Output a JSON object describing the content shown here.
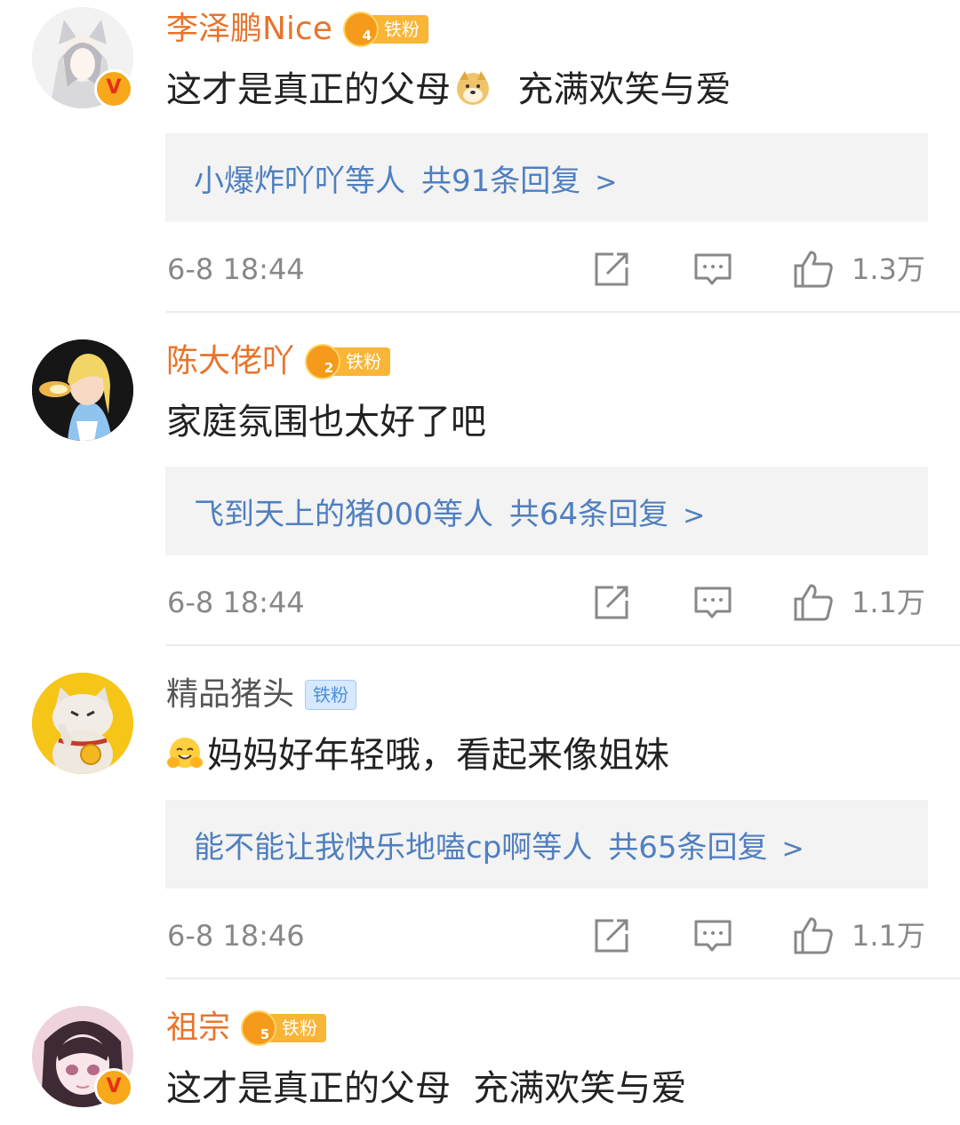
{
  "comments": [
    {
      "username": "李泽鹏Nice",
      "name_style": "vip",
      "verified": true,
      "fan_level": "4",
      "fan_label": "铁粉",
      "text_before": "这才是真正的父母",
      "emoji": "doge-emoji",
      "text_after": "  充满欢笑与爱",
      "reply_users": "小爆炸吖吖",
      "reply_suffix": "等人",
      "reply_count": "共91条回复",
      "time": "6-8 18:44",
      "likes": "1.3万"
    },
    {
      "username": "陈大佬吖",
      "name_style": "vip",
      "verified": false,
      "fan_level": "2",
      "fan_label": "铁粉",
      "text": "家庭氛围也太好了吧",
      "reply_users": "飞到天上的猪000",
      "reply_suffix": "等人",
      "reply_count": "共64条回复",
      "time": "6-8 18:44",
      "likes": "1.1万"
    },
    {
      "username": "精品猪头",
      "name_style": "plain",
      "verified": false,
      "fan_label": "铁粉",
      "emoji": "hug-emoji",
      "text": "妈妈好年轻哦，看起来像姐妹",
      "reply_users": "能不能让我快乐地嗑cp啊",
      "reply_suffix": "等人",
      "reply_count": "共65条回复",
      "time": "6-8 18:46",
      "likes": "1.1万"
    },
    {
      "username": "祖宗",
      "name_style": "vip",
      "verified": true,
      "fan_level": "5",
      "fan_label": "铁粉",
      "text": "这才是真正的父母  充满欢笑与爱"
    }
  ],
  "reply_chevron": ">",
  "colors": {
    "vip_name": "#e8742c",
    "link_blue": "#4f7fbf",
    "reply_bg": "#f3f3f3",
    "meta_gray": "#888888",
    "badge_orange": "#f9b536"
  }
}
